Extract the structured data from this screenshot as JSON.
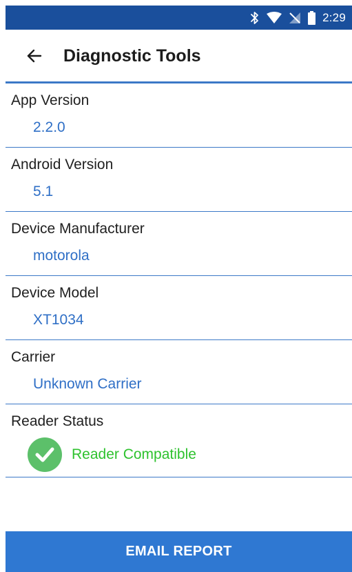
{
  "status_bar": {
    "time": "2:29",
    "icons": [
      "bluetooth-icon",
      "wifi-icon",
      "no-signal-icon",
      "battery-icon"
    ],
    "background": "#1a4f9c"
  },
  "app_bar": {
    "back_icon": "arrow-left-icon",
    "title": "Diagnostic Tools"
  },
  "items": [
    {
      "label": "App Version",
      "value": "2.2.0"
    },
    {
      "label": "Android Version",
      "value": "5.1"
    },
    {
      "label": "Device Manufacturer",
      "value": "motorola"
    },
    {
      "label": "Device Model",
      "value": "XT1034"
    },
    {
      "label": "Carrier",
      "value": "Unknown Carrier"
    }
  ],
  "reader_status": {
    "label": "Reader Status",
    "icon": "check-circle-icon",
    "value": "Reader Compatible",
    "color": "#2ec22e"
  },
  "email_button": {
    "label": "EMAIL REPORT",
    "color": "#2f78d2"
  },
  "colors": {
    "accent": "#2f6fc6",
    "divider": "#3b78c7"
  }
}
